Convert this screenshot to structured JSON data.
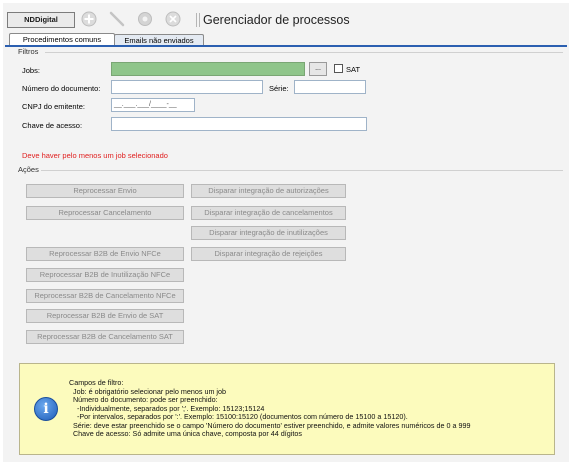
{
  "app": {
    "logo": "NDDigital",
    "title": "Gerenciador de processos"
  },
  "toolbar": {
    "icons": [
      "add-icon",
      "tools-icon",
      "settings-icon",
      "close-icon"
    ]
  },
  "tabs": [
    {
      "label": "Procedimentos comuns",
      "active": true
    },
    {
      "label": "Emails não enviados",
      "active": false
    }
  ],
  "filters": {
    "group_label": "Filtros",
    "jobs_label": "Jobs:",
    "browse_label": "...",
    "sat_label": "SAT",
    "sat_checked": false,
    "doc_number_label": "Número do documento:",
    "doc_number_value": "",
    "serie_label": "Série:",
    "serie_value": "",
    "cnpj_label": "CNPJ do emitente:",
    "cnpj_mask": "__.___.___/____-__",
    "access_key_label": "Chave de acesso:",
    "access_key_value": "",
    "error": "Deve haver pelo menos um job selecionado"
  },
  "actions": {
    "group_label": "Ações",
    "left_buttons": [
      "Reprocessar Envio",
      "Reprocessar Cancelamento",
      "Reprocessar B2B de Envio NFCe",
      "Reprocessar B2B de Inutilização NFCe",
      "Reprocessar B2B de Cancelamento NFCe",
      "Reprocessar B2B de Envio de SAT",
      "Reprocessar B2B de Cancelamento SAT"
    ],
    "right_buttons": [
      "Disparar integração de autorizações",
      "Disparar integração de cancelamentos",
      "Disparar integração de inutilizações",
      "Disparar integração de rejeições"
    ]
  },
  "info": {
    "icon": "info-icon",
    "lines": [
      "Campos de filtro:",
      "  Job: é obrigatório selecionar pelo menos um job",
      "  Número do documento: pode ser preenchido:",
      "    -Individualmente, separados por ';'. Exemplo: 15123;15124",
      "    -Por intervalos, separados por ':'. Exemplo: 15100:15120 (documentos com número de 15100 a 15120).",
      "  Série: deve estar preenchido se o campo 'Número do documento' estiver preenchido, e admite valores numéricos de 0 a 999",
      "  Chave de acesso: Só admite uma única chave, composta por 44 dígitos"
    ]
  }
}
